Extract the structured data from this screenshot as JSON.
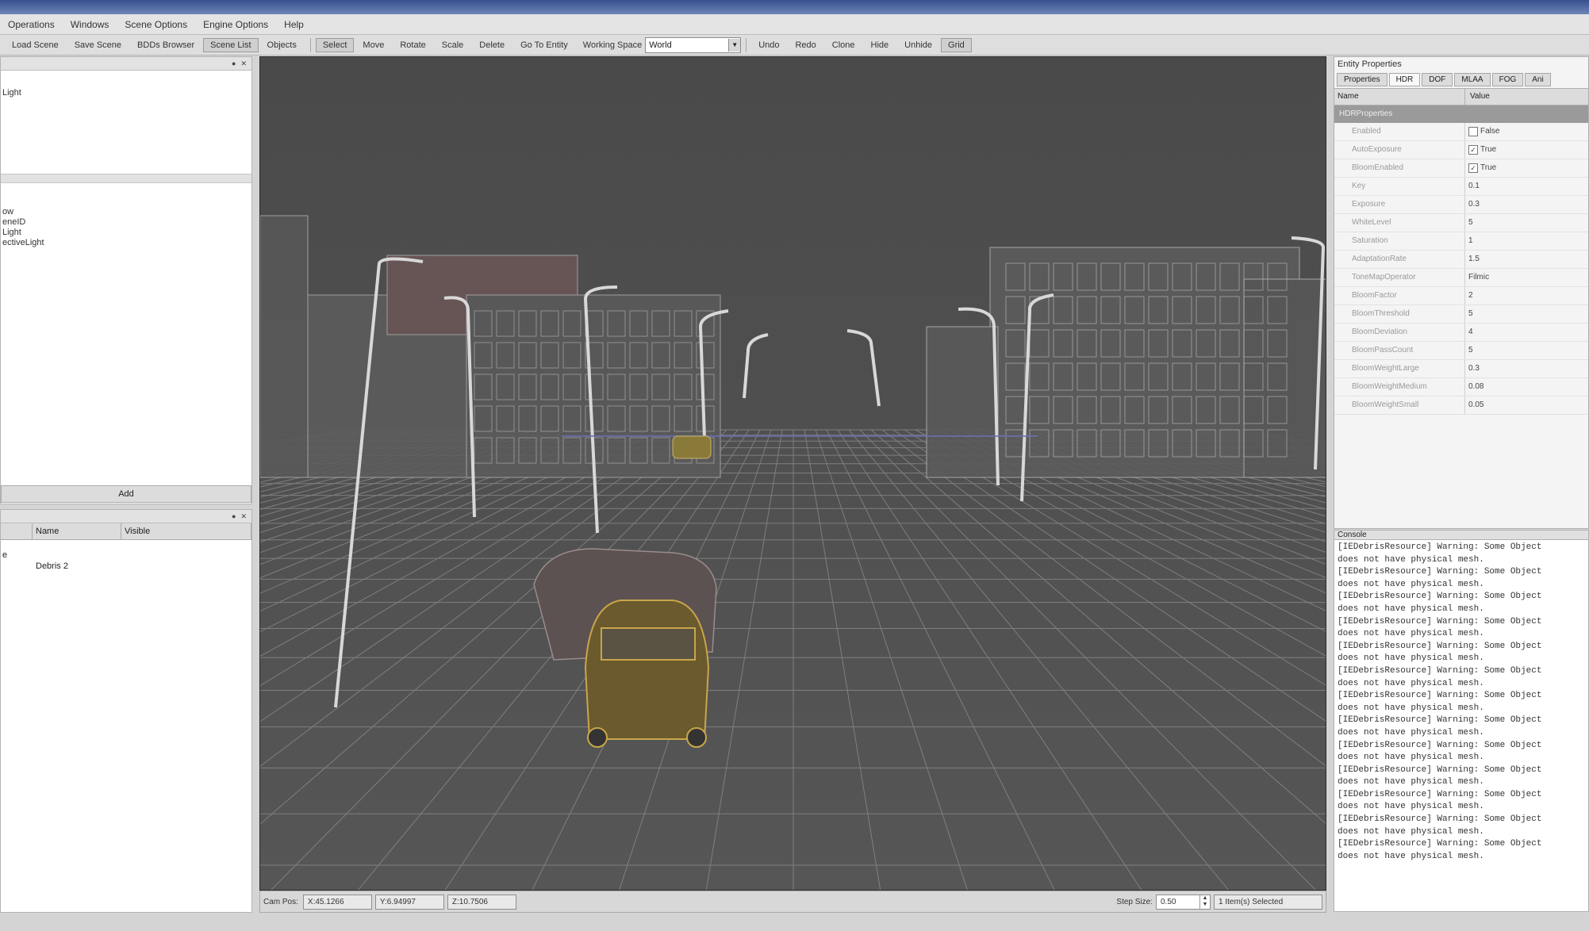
{
  "menu": [
    "Operations",
    "Windows",
    "Scene Options",
    "Engine Options",
    "Help"
  ],
  "toolbar": {
    "left": [
      "Load Scene",
      "Save Scene",
      "BDDs Browser",
      "Scene List",
      "Objects"
    ],
    "modes": [
      "Select",
      "Move",
      "Rotate",
      "Scale",
      "Delete",
      "Go To Entity"
    ],
    "working_space_label": "Working Space",
    "working_space_value": "World",
    "right": [
      "Undo",
      "Redo",
      "Clone",
      "Hide",
      "Unhide",
      "Grid"
    ]
  },
  "scene_panel": {
    "top_items": [
      "Light"
    ],
    "mid_items": [
      "ow",
      "eneID",
      "Light",
      "ectiveLight"
    ],
    "add_label": "Add"
  },
  "layers_panel": {
    "columns": [
      "",
      "Name",
      "Visible"
    ],
    "rows": [
      [
        "e",
        "Debris 2",
        ""
      ]
    ]
  },
  "viewport": {
    "scene": "wireframe-city-street-with-cars"
  },
  "statusbar": {
    "cam_pos_label": "Cam Pos:",
    "x": "X:45.1266",
    "y": "Y:6.94997",
    "z": "Z:10.7506",
    "step_size_label": "Step Size:",
    "step_size": "0.50",
    "selection": "1 Item(s) Selected"
  },
  "properties": {
    "title": "Entity Properties",
    "tabs": [
      "Properties",
      "HDR",
      "DOF",
      "MLAA",
      "FOG",
      "Ani"
    ],
    "columns": [
      "Name",
      "Value"
    ],
    "group": "HDRProperties",
    "rows": [
      {
        "name": "Enabled",
        "value": "False",
        "check": false
      },
      {
        "name": "AutoExposure",
        "value": "True",
        "check": true
      },
      {
        "name": "BloomEnabled",
        "value": "True",
        "check": true
      },
      {
        "name": "Key",
        "value": "0.1",
        "check": null
      },
      {
        "name": "Exposure",
        "value": "0.3",
        "check": null
      },
      {
        "name": "WhiteLevel",
        "value": "5",
        "check": null
      },
      {
        "name": "Saturation",
        "value": "1",
        "check": null
      },
      {
        "name": "AdaptationRate",
        "value": "1.5",
        "check": null
      },
      {
        "name": "ToneMapOperator",
        "value": "Filmic",
        "check": null
      },
      {
        "name": "BloomFactor",
        "value": "2",
        "check": null
      },
      {
        "name": "BloomThreshold",
        "value": "5",
        "check": null
      },
      {
        "name": "BloomDeviation",
        "value": "4",
        "check": null
      },
      {
        "name": "BloomPassCount",
        "value": "5",
        "check": null
      },
      {
        "name": "BloomWeightLarge",
        "value": "0.3",
        "check": null
      },
      {
        "name": "BloomWeightMedium",
        "value": "0.08",
        "check": null
      },
      {
        "name": "BloomWeightSmall",
        "value": "0.05",
        "check": null
      }
    ]
  },
  "console": {
    "title": "Console",
    "lines": [
      "[IEDebrisResource] Warning: Some Object",
      "does not have physical mesh.",
      "[IEDebrisResource] Warning: Some Object",
      "does not have physical mesh.",
      "[IEDebrisResource] Warning: Some Object",
      "does not have physical mesh.",
      "[IEDebrisResource] Warning: Some Object",
      "does not have physical mesh.",
      "[IEDebrisResource] Warning: Some Object",
      "does not have physical mesh.",
      "[IEDebrisResource] Warning: Some Object",
      "does not have physical mesh.",
      "[IEDebrisResource] Warning: Some Object",
      "does not have physical mesh.",
      "[IEDebrisResource] Warning: Some Object",
      "does not have physical mesh.",
      "[IEDebrisResource] Warning: Some Object",
      "does not have physical mesh.",
      "[IEDebrisResource] Warning: Some Object",
      "does not have physical mesh.",
      "[IEDebrisResource] Warning: Some Object",
      "does not have physical mesh.",
      "[IEDebrisResource] Warning: Some Object",
      "does not have physical mesh.",
      "[IEDebrisResource] Warning: Some Object",
      "does not have physical mesh."
    ]
  }
}
